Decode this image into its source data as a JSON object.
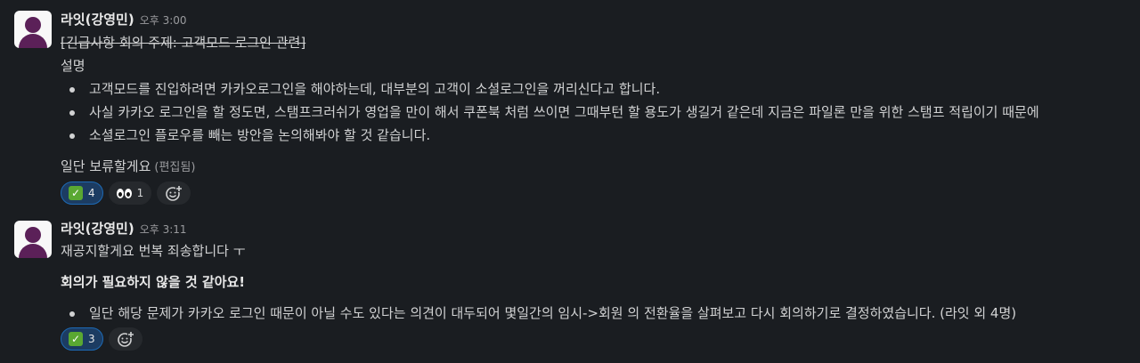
{
  "messages": [
    {
      "author": "라잇(강영민)",
      "time": "오후 3:00",
      "title_struck": "[긴급사항 회의 주제: 고객모드 로그인 관련]",
      "section_label": "설명",
      "bullets": [
        "고객모드를 진입하려면 카카오로그인을 해야하는데, 대부분의 고객이 소셜로그인을 꺼리신다고 합니다.",
        "사실 카카오 로그인을 할 정도면, 스탬프크러쉬가 영업을 만이 해서 쿠폰북 처럼 쓰이면 그때부턴 할 용도가 생길거 같은데 지금은 파일론 만을 위한 스탬프 적립이기 때문에",
        "소셜로그인 플로우를 빼는 방안을 논의해봐야 할 것 같습니다."
      ],
      "closing": "일단 보류할게요",
      "edited": "(편집됨)",
      "reactions": [
        {
          "emoji": "white-check-mark",
          "count": "4",
          "mine": true
        },
        {
          "emoji": "eyes",
          "count": "1",
          "mine": false
        }
      ]
    },
    {
      "author": "라잇(강영민)",
      "time": "오후 3:11",
      "line1": "재공지할게요 번복 죄송합니다 ㅜ",
      "bold_line": "회의가 필요하지 않을 것 같아요!",
      "bullets": [
        "일단 해당 문제가 카카오 로그인 때문이 아닐 수도 있다는 의견이 대두되어 몇일간의 임시->회원 의 전환율을 살펴보고 다시 회의하기로 결정하였습니다. (라잇 외 4명)"
      ],
      "reactions": [
        {
          "emoji": "white-check-mark",
          "count": "3",
          "mine": true
        }
      ]
    }
  ],
  "icons": {
    "add_reaction": "add-reaction-icon",
    "avatar": "default-avatar"
  },
  "colors": {
    "background": "#1a1d21",
    "text": "#d1d2d3",
    "reaction_active_bg": "#1c3c62",
    "reaction_active_border": "#1d6ab5",
    "avatar_fg": "#5b2058"
  }
}
